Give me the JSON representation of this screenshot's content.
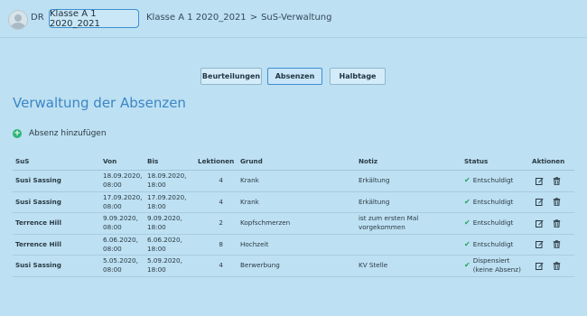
{
  "header": {
    "initials": "DR",
    "class_selector": "Klasse A 1 2020_2021",
    "breadcrumb": [
      "Klasse A 1 2020_2021",
      "SuS-Verwaltung"
    ],
    "breadcrumb_sep": ">"
  },
  "tabs": [
    {
      "label": "Beurteilungen",
      "active": false
    },
    {
      "label": "Absenzen",
      "active": true
    },
    {
      "label": "Halbtage",
      "active": false
    }
  ],
  "page_title": "Verwaltung der Absenzen",
  "add_label": "Absenz hinzufügen",
  "table": {
    "columns": [
      "SuS",
      "Von",
      "Bis",
      "Lektionen",
      "Grund",
      "Notiz",
      "Status",
      "Aktionen"
    ],
    "rows": [
      {
        "sus": "Susi Sassing",
        "von": [
          "18.09.2020,",
          "08:00"
        ],
        "bis": [
          "18.09.2020,",
          "18:00"
        ],
        "lektionen": "4",
        "grund": "Krank",
        "notiz": "Erkältung",
        "status": [
          "Entschuldigt"
        ]
      },
      {
        "sus": "Susi Sassing",
        "von": [
          "17.09.2020,",
          "08:00"
        ],
        "bis": [
          "17.09.2020,",
          "18:00"
        ],
        "lektionen": "4",
        "grund": "Krank",
        "notiz": "Erkältung",
        "status": [
          "Entschuldigt"
        ]
      },
      {
        "sus": "Terrence Hill",
        "von": [
          "9.09.2020,",
          "08:00"
        ],
        "bis": [
          "9.09.2020,",
          "18:00"
        ],
        "lektionen": "2",
        "grund": "Kopfschmerzen",
        "notiz": "ist zum ersten Mal vorgekommen",
        "status": [
          "Entschuldigt"
        ]
      },
      {
        "sus": "Terrence Hill",
        "von": [
          "6.06.2020,",
          "08:00"
        ],
        "bis": [
          "6.06.2020,",
          "18:00"
        ],
        "lektionen": "8",
        "grund": "Hochzeit",
        "notiz": "",
        "status": [
          "Entschuldigt"
        ]
      },
      {
        "sus": "Susi Sassing",
        "von": [
          "5.05.2020,",
          "08:00"
        ],
        "bis": [
          "5.09.2020,",
          "18:00"
        ],
        "lektionen": "4",
        "grund": "Berwerbung",
        "notiz": "KV Stelle",
        "status": [
          "Dispensiert",
          "(keine Absenz)"
        ]
      }
    ]
  },
  "colors": {
    "accent": "#3b86c6",
    "background": "#bde0f2",
    "success": "#24a55f",
    "add": "#2fb578"
  },
  "icons": {
    "edit": "edit-icon",
    "delete": "trash-icon",
    "status": "check-icon",
    "add": "plus-circle-icon"
  }
}
